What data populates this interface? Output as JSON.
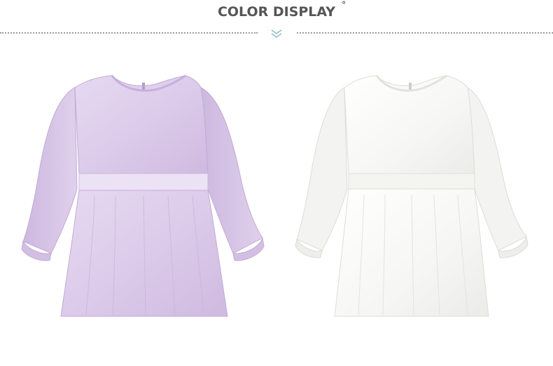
{
  "header": {
    "title": "COLOR DISPLAY",
    "title_mark": "°",
    "chevron_icon": "double-chevron-down-icon",
    "divider_style": "dotted",
    "accent_color": "#8fc0bf"
  },
  "products": [
    {
      "item": "blouse",
      "color_hex": "#d9c8ea"
    },
    {
      "item": "blouse",
      "color_hex": "#f7f7f5"
    }
  ]
}
